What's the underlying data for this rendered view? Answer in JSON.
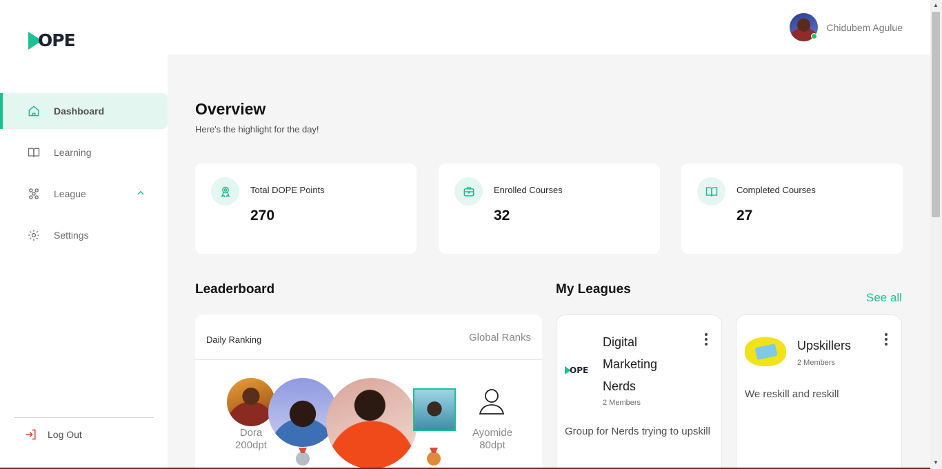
{
  "app": {
    "logo_text": "OPE"
  },
  "sidebar": {
    "items": [
      {
        "label": "Dashboard",
        "icon": "home-icon",
        "active": true
      },
      {
        "label": "Learning",
        "icon": "book-icon"
      },
      {
        "label": "League",
        "icon": "group-icon",
        "expanded": true
      },
      {
        "label": "Settings",
        "icon": "gear-icon"
      }
    ],
    "logout_label": "Log Out"
  },
  "header": {
    "user_name": "Chidubem Agulue",
    "online": true
  },
  "overview": {
    "title": "Overview",
    "subtitle": "Here's the highlight for the day!"
  },
  "stats": [
    {
      "label": "Total DOPE Points",
      "value": "270",
      "icon": "award-icon"
    },
    {
      "label": "Enrolled Courses",
      "value": "32",
      "icon": "briefcase-icon"
    },
    {
      "label": "Completed Courses",
      "value": "27",
      "icon": "book-icon"
    }
  ],
  "leaderboard": {
    "title": "Leaderboard",
    "tab_daily": "Daily Ranking",
    "tab_global": "Global Ranks",
    "ranks": [
      {
        "name": "Dora",
        "points": "200dpt"
      },
      {
        "name": "Ayomide",
        "points": "80dpt"
      }
    ]
  },
  "leagues": {
    "title": "My Leagues",
    "see_all": "See all",
    "items": [
      {
        "name_lines": [
          "Digital",
          "Marketing",
          "Nerds"
        ],
        "members": "2 Members",
        "description": "Group for Nerds trying to upskill",
        "logo_text": "OPE"
      },
      {
        "name": "Upskillers",
        "members": "2 Members",
        "description": "We reskill and reskill"
      }
    ]
  },
  "colors": {
    "accent": "#1fbf94",
    "accent_light": "#e3f6ef",
    "dark": "#1c2230"
  }
}
